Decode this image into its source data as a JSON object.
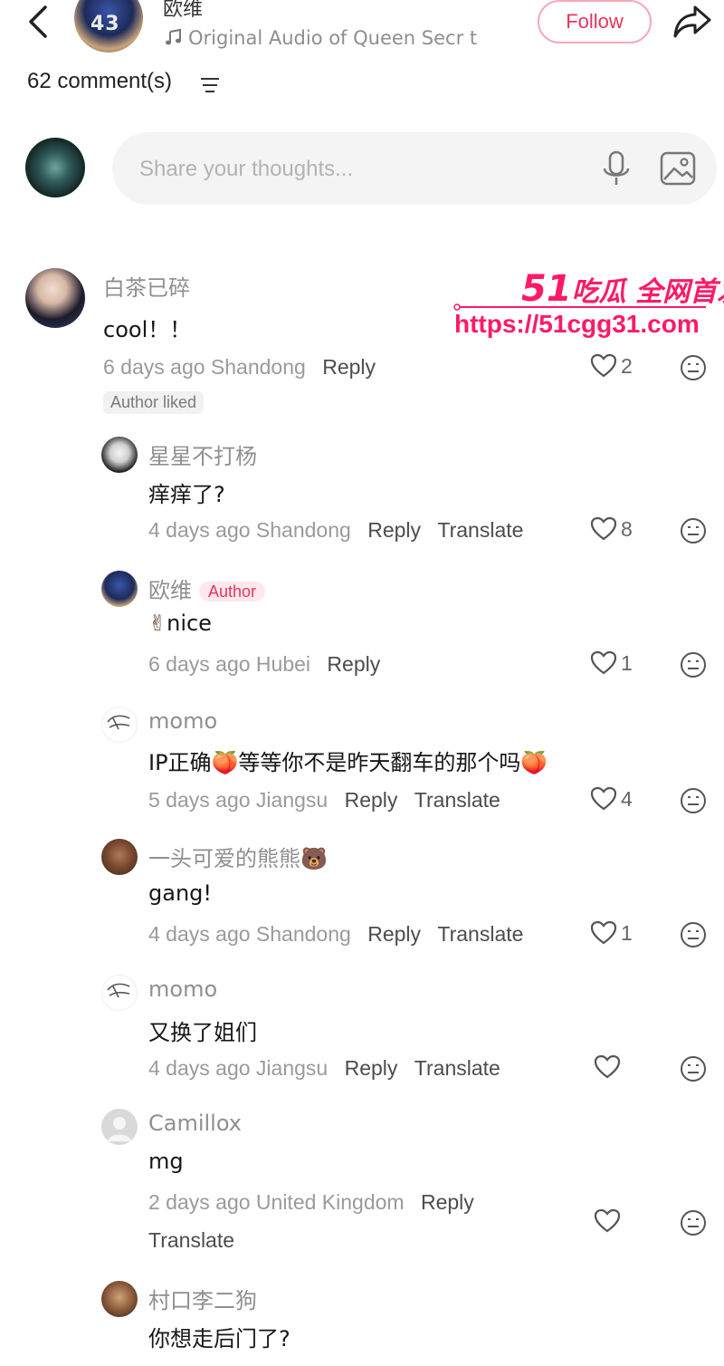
{
  "header": {
    "author_name": "欧维",
    "avatar_overlay": "43",
    "audio_label": "Original Audio of Queen Secr t",
    "follow_label": "Follow"
  },
  "comments_header": {
    "count_label": "62 comment(s)"
  },
  "composer": {
    "placeholder": "Share your thoughts..."
  },
  "watermark": {
    "line1_big": "51",
    "line1": "吃瓜 全网首发",
    "url": "https://51cgg31.com"
  },
  "comments": [
    {
      "name": "白茶已碎",
      "text": "cool！！",
      "time": "6 days ago",
      "location": "Shandong",
      "reply": "Reply",
      "likes": "2",
      "badge": "Author liked"
    },
    {
      "name": "星星不打杨",
      "text": "痒痒了?",
      "time": "4 days ago",
      "location": "Shandong",
      "reply": "Reply",
      "translate": "Translate",
      "likes": "8"
    },
    {
      "name": "欧维",
      "tag": "Author",
      "text": "nice",
      "emoji": "✌",
      "time": "6 days ago",
      "location": "Hubei",
      "reply": "Reply",
      "likes": "1"
    },
    {
      "name": "momo",
      "text": "IP正确🍑等等你不是昨天翻车的那个吗🍑",
      "time": "5 days ago",
      "location": "Jiangsu",
      "reply": "Reply",
      "translate": "Translate",
      "likes": "4"
    },
    {
      "name": "一头可爱的熊熊🐻",
      "text": "gang!",
      "time": "4 days ago",
      "location": "Shandong",
      "reply": "Reply",
      "translate": "Translate",
      "likes": "1"
    },
    {
      "name": "momo",
      "text": "又换了姐们",
      "time": "4 days ago",
      "location": "Jiangsu",
      "reply": "Reply",
      "translate": "Translate",
      "likes": ""
    },
    {
      "name": "Camillox",
      "text": "mg",
      "time": "2 days ago",
      "location": "United Kingdom",
      "reply": "Reply",
      "translate": "Translate",
      "likes": ""
    },
    {
      "name": "村口李二狗",
      "text": "你想走后门了?"
    }
  ],
  "colors": {
    "accent": "#e7335c",
    "watermark": "#ff1a66"
  }
}
